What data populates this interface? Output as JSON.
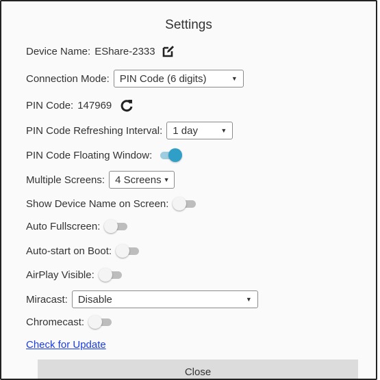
{
  "dialog": {
    "title": "Settings",
    "close_label": "Close",
    "check_update_label": "Check for Update"
  },
  "device_name": {
    "label": "Device Name:",
    "value": "EShare-2333",
    "icon": "edit-icon"
  },
  "connection_mode": {
    "label": "Connection Mode:",
    "selected": "PIN Code (6 digits)"
  },
  "pin_code": {
    "label": "PIN Code:",
    "value": "147969",
    "icon": "refresh-icon"
  },
  "pin_refresh": {
    "label": "PIN Code Refreshing Interval:",
    "selected": "1 day"
  },
  "pin_floating": {
    "label": "PIN Code Floating Window:",
    "on": true
  },
  "multiple_screens": {
    "label": "Multiple Screens:",
    "selected": "4 Screens"
  },
  "show_device_name": {
    "label": "Show Device Name on Screen:",
    "on": false
  },
  "auto_fullscreen": {
    "label": "Auto Fullscreen:",
    "on": false
  },
  "auto_start": {
    "label": "Auto-start on Boot:",
    "on": false
  },
  "airplay": {
    "label": "AirPlay Visible:",
    "on": false
  },
  "miracast": {
    "label": "Miracast:",
    "selected": "Disable"
  },
  "chromecast": {
    "label": "Chromecast:",
    "on": false
  },
  "colors": {
    "accent": "#2f9fc8",
    "link": "#1a3ce8",
    "close_button_bg": "#dcdcdc"
  }
}
